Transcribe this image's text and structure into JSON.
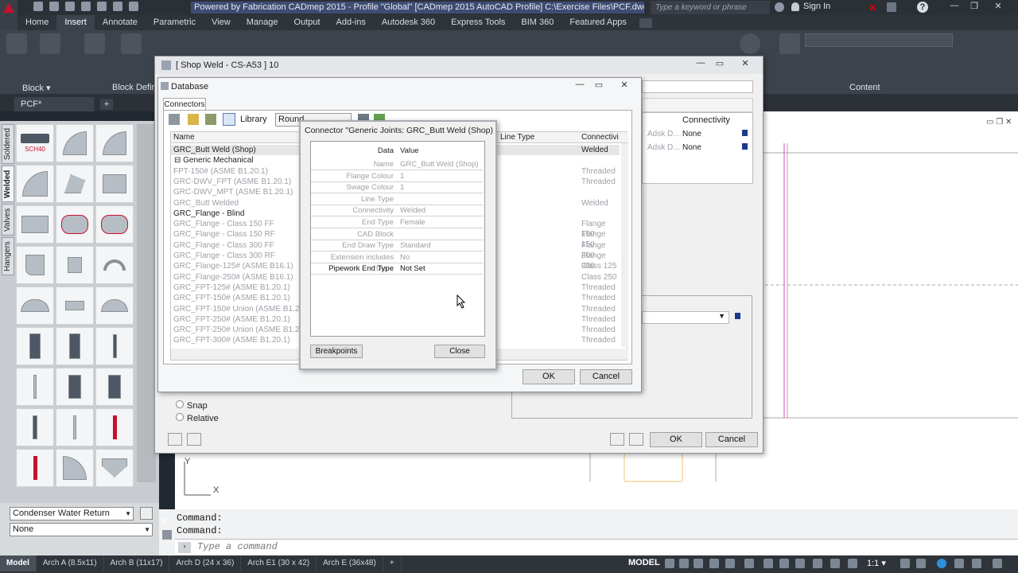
{
  "titlebar": {
    "title": "Powered by Fabrication CADmep 2015 - Profile \"Global\"  [CADmep 2015 AutoCAD Profile]    C:\\Exercise Files\\PCF.dwg",
    "search_placeholder": "Type a keyword or phrase",
    "signin_label": "Sign In"
  },
  "ribbon": {
    "tabs": [
      "Home",
      "Insert",
      "Annotate",
      "Parametric",
      "View",
      "Manage",
      "Output",
      "Add-ins",
      "Autodesk 360",
      "Express Tools",
      "BIM 360",
      "Featured Apps"
    ],
    "active_tab": "Insert",
    "panels": [
      {
        "label": "Block ▾"
      },
      {
        "label": "Block Defini"
      },
      {
        "label": "Content"
      }
    ]
  },
  "document": {
    "tab_label": "PCF*",
    "add_tab": "+"
  },
  "palette": {
    "tabs": [
      "Soldered",
      "Welded",
      "Valves",
      "Hangers"
    ],
    "active_tab": "Welded",
    "first_tool_caption": "SCH40",
    "layer_combo": "Condenser Water Return",
    "second_combo": "None"
  },
  "shop_weld_dialog": {
    "title": "[ Shop Weld - CS-A53 ]  10",
    "options": [
      "Snap",
      "Relative"
    ],
    "ok_label": "OK",
    "cancel_label": "Cancel",
    "right_header": "Connectivity",
    "right_rows": [
      {
        "col1": "Adsk D...",
        "col2": "None"
      },
      {
        "col1": "Adsk D...",
        "col2": "None"
      }
    ]
  },
  "database_dialog": {
    "title": "Database",
    "tab": "Connectors",
    "library_label": "Library",
    "round_value": "Round",
    "columns": [
      "Name",
      "Line Type",
      "Connectivi"
    ],
    "rows": [
      {
        "name": "GRC_Butt Weld (Shop)",
        "conn": "Welded",
        "style": "selected"
      },
      {
        "name": "⊟  Generic Mechanical",
        "conn": "",
        "style": "group"
      },
      {
        "name": "FPT-150# (ASME B1.20.1)",
        "conn": "Threaded",
        "style": "greyed"
      },
      {
        "name": "GRC-DWV_FPT (ASME B1.20.1)",
        "conn": "Threaded",
        "style": "greyed"
      },
      {
        "name": "GRC-DWV_MPT (ASME B1.20.1)",
        "conn": "",
        "style": "greyed"
      },
      {
        "name": "GRC_Butt Welded",
        "conn": "Welded",
        "style": "greyed"
      },
      {
        "name": "GRC_Flange - Blind",
        "conn": "",
        "style": "normal"
      },
      {
        "name": "GRC_Flange - Class 150 FF",
        "conn": "Flange 150",
        "style": "greyed"
      },
      {
        "name": "GRC_Flange - Class 150 RF",
        "conn": "Flange 150",
        "style": "greyed"
      },
      {
        "name": "GRC_Flange - Class 300 FF",
        "conn": "Flange 300",
        "style": "greyed"
      },
      {
        "name": "GRC_Flange - Class 300 RF",
        "conn": "Flange 300",
        "style": "greyed"
      },
      {
        "name": "GRC_Flange-125# (ASME B16.1)",
        "conn": "Class 125",
        "style": "greyed"
      },
      {
        "name": "GRC_Flange-250# (ASME B16.1)",
        "conn": "Class 250",
        "style": "greyed"
      },
      {
        "name": "GRC_FPT-125# (ASME B1.20.1)",
        "conn": "Threaded",
        "style": "greyed"
      },
      {
        "name": "GRC_FPT-150# (ASME B1.20.1)",
        "conn": "Threaded",
        "style": "greyed"
      },
      {
        "name": "GRC_FPT-150# Union (ASME B1.20.1)",
        "conn": "Threaded",
        "style": "greyed"
      },
      {
        "name": "GRC_FPT-250# (ASME B1.20.1)",
        "conn": "Threaded",
        "style": "greyed"
      },
      {
        "name": "GRC_FPT-250# Union (ASME B1.20.1)",
        "conn": "Threaded",
        "style": "greyed"
      },
      {
        "name": "GRC_FPT-300# (ASME B1.20.1)",
        "conn": "Threaded",
        "style": "greyed"
      }
    ],
    "ok_label": "OK",
    "cancel_label": "Cancel"
  },
  "connector_dialog": {
    "title": "Connector \"Generic Joints: GRC_Butt Weld (Shop)  {A...",
    "header_data": "Data",
    "header_value": "Value",
    "properties": [
      {
        "key": "Name",
        "value": "GRC_Butt Weld (Shop)",
        "enabled": false
      },
      {
        "key": "Flange Colour",
        "value": "1",
        "enabled": false
      },
      {
        "key": "Swage Colour",
        "value": "1",
        "enabled": false
      },
      {
        "key": "Line Type",
        "value": "",
        "enabled": false
      },
      {
        "key": "Connectivity",
        "value": "Welded",
        "enabled": false
      },
      {
        "key": "End Type",
        "value": "Female",
        "enabled": false
      },
      {
        "key": "CAD Block",
        "value": "",
        "enabled": false
      },
      {
        "key": "End Draw Type",
        "value": "Standard",
        "enabled": false
      },
      {
        "key": "Extension includes Dia...",
        "value": "No",
        "enabled": false
      },
      {
        "key": "Pipework End Type",
        "value": "Not Set",
        "enabled": true
      }
    ],
    "breakpoints_label": "Breakpoints",
    "close_label": "Close"
  },
  "command_line": {
    "history": [
      "Command:",
      "Command:"
    ],
    "placeholder": "Type a command"
  },
  "statusbar": {
    "layout_tabs": [
      "Model",
      "Arch A (8.5x11)",
      "Arch B (11x17)",
      "Arch D (24 x 36)",
      "Arch E1 (30 x 42)",
      "Arch E (36x48)",
      "+"
    ],
    "active_layout": "Model",
    "model_label": "MODEL",
    "scale": "1:1 ▾"
  },
  "colors": {
    "accent": "#c8102e",
    "title_highlight": "#3d4c72",
    "magenta_line": "#e040c8"
  }
}
